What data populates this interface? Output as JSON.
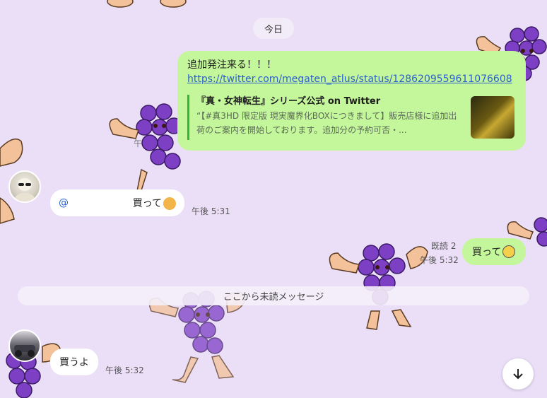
{
  "chat": {
    "date_label": "今日",
    "unread_label": "ここから未読メッセージ"
  },
  "messages": {
    "sent1": {
      "text": "追加発注来る！！！",
      "link": "https://twitter.com/megaten_atlus/status/1286209559611076608",
      "preview_title": "『真・女神転生』シリーズ公式 on Twitter",
      "preview_desc": "“【#真3HD 限定版 現実魔界化BOXにつきまして】販売店様に追加出荷のご案内を開始しております。追加分の予約可否・...",
      "time_partial": "午"
    },
    "recv1": {
      "mention": "@",
      "text": "買って",
      "emoji": "drooling-face",
      "time": "午後 5:31"
    },
    "sent2": {
      "read_label": "既読 2",
      "time": "午後 5:32",
      "text": "買って",
      "emoji": "dizzy-face"
    },
    "recv2": {
      "text": "買うよ",
      "time": "午後 5:32"
    }
  },
  "controls": {
    "scroll_down_icon": "arrow-down-icon"
  },
  "colors": {
    "background": "#ebdff8",
    "sent_bubble": "#c4f79b",
    "link": "#2b5fcf",
    "preview_bar": "#35b535"
  }
}
